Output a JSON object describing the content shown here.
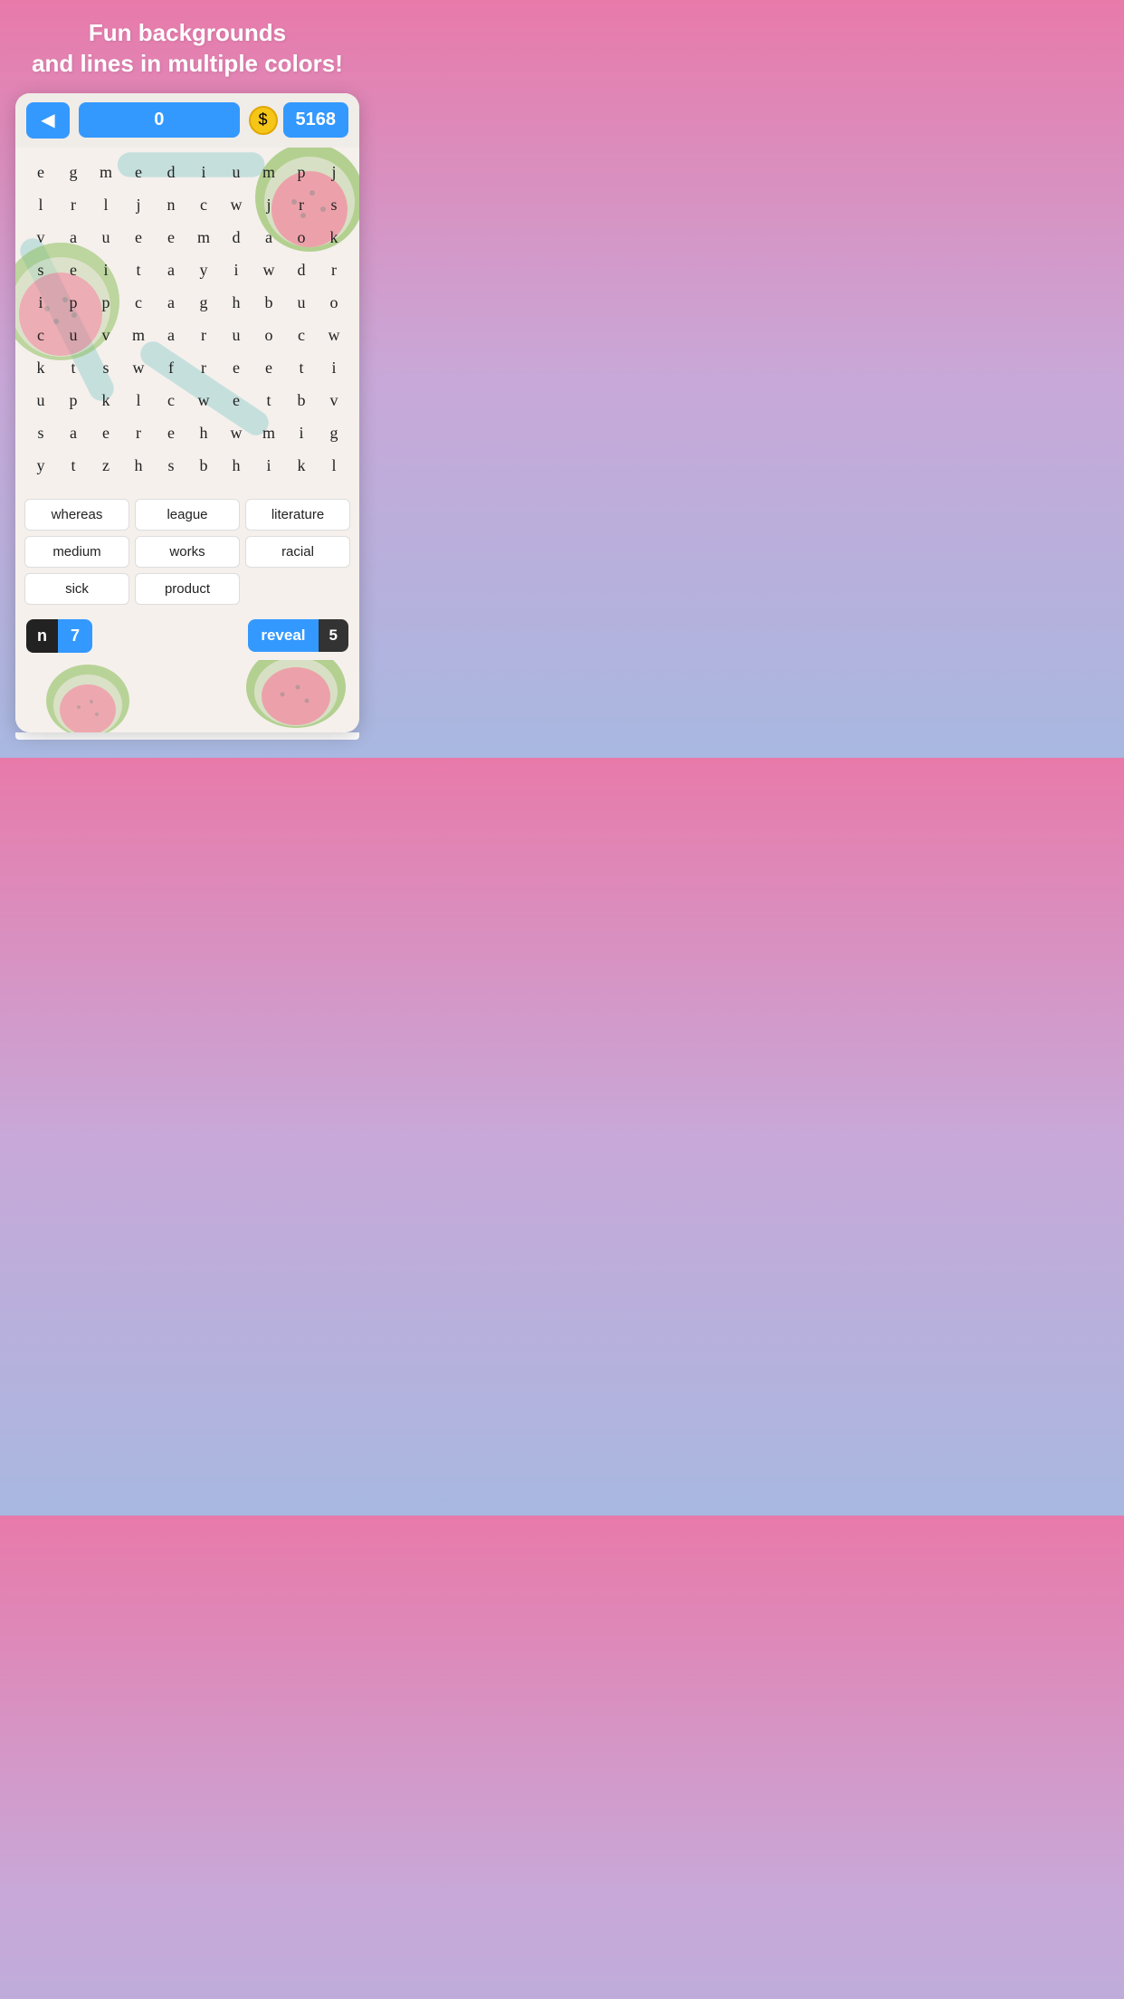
{
  "header": {
    "line1": "Fun backgrounds",
    "line2": "and lines in multiple colors!"
  },
  "topbar": {
    "back_label": "◀",
    "score": "0",
    "coin_icon": "$",
    "coins": "5168"
  },
  "grid": {
    "cells": [
      "e",
      "g",
      "m",
      "e",
      "d",
      "i",
      "u",
      "m",
      "p",
      "j",
      "l",
      "r",
      "l",
      "j",
      "n",
      "c",
      "w",
      "j",
      "r",
      "s",
      "v",
      "a",
      "u",
      "e",
      "e",
      "m",
      "d",
      "a",
      "o",
      "k",
      "s",
      "e",
      "i",
      "t",
      "a",
      "y",
      "i",
      "w",
      "d",
      "r",
      "i",
      "p",
      "p",
      "c",
      "a",
      "g",
      "h",
      "b",
      "u",
      "o",
      "c",
      "u",
      "v",
      "m",
      "a",
      "r",
      "u",
      "o",
      "c",
      "w",
      "k",
      "t",
      "s",
      "w",
      "f",
      "r",
      "e",
      "e",
      "t",
      "i",
      "u",
      "p",
      "k",
      "l",
      "c",
      "w",
      "e",
      "t",
      "b",
      "v",
      "s",
      "a",
      "e",
      "r",
      "e",
      "h",
      "w",
      "m",
      "i",
      "g",
      "y",
      "t",
      "z",
      "h",
      "s",
      "b",
      "h",
      "i",
      "k",
      "l"
    ]
  },
  "words": [
    {
      "label": "whereas",
      "found": false
    },
    {
      "label": "league",
      "found": false
    },
    {
      "label": "literature",
      "found": false
    },
    {
      "label": "medium",
      "found": false
    },
    {
      "label": "works",
      "found": false
    },
    {
      "label": "racial",
      "found": false
    },
    {
      "label": "sick",
      "found": false
    },
    {
      "label": "product",
      "found": false
    }
  ],
  "bottombar": {
    "hint_letter": "n",
    "hint_count": "7",
    "reveal_label": "reveal",
    "reveal_count": "5"
  }
}
